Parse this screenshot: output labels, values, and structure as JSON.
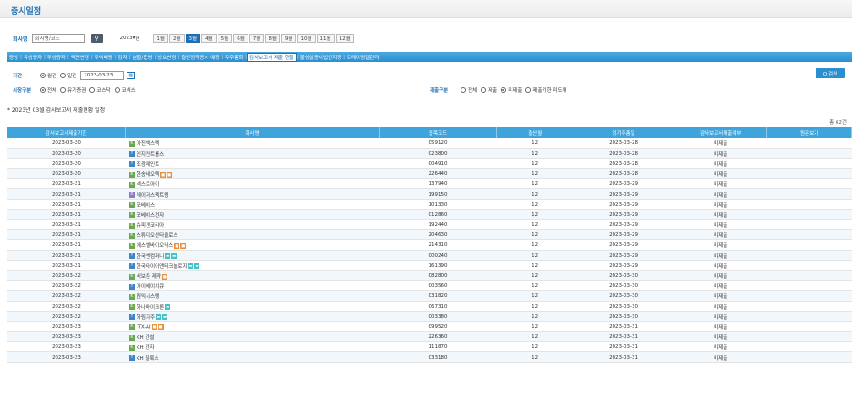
{
  "header": {
    "title": "증시일정"
  },
  "search": {
    "company_label": "회사명",
    "company_placeholder": "회사명/코드",
    "year": "2023",
    "year_suffix": "년",
    "months": [
      "1월",
      "2월",
      "3월",
      "4월",
      "5월",
      "6월",
      "7월",
      "8월",
      "9월",
      "10월",
      "11월",
      "12월"
    ],
    "active_month_index": 2
  },
  "menu": {
    "items": [
      "증암",
      "유상증자",
      "무상증자",
      "액면변경",
      "주식배당",
      "감자",
      "분할/합병",
      "상호변경",
      "결산정적공시 예정",
      "주주총회",
      "감사보고서 제출 현황",
      "불성실공시법인지정",
      "트레이딩캘린더"
    ],
    "active_index": 10
  },
  "filters": {
    "period_label": "기간",
    "period_opt1": "월간",
    "period_opt2": "일간",
    "date_value": "2023-03-23",
    "market_label": "시장구분",
    "market_opts": [
      "전체",
      "유가증권",
      "코스닥",
      "코넥스"
    ],
    "submit_label": "제출구분",
    "submit_opts": [
      "전체",
      "제출",
      "미제출",
      "제출기한 미도래"
    ],
    "search_btn": "Q 검색"
  },
  "caption": "* 2023년 03월 감사보고서 제출현황 일정",
  "total": "총 62건",
  "table": {
    "headers": [
      "감사보고서제출기한",
      "회사명",
      "종목코드",
      "결산월",
      "정기주총일",
      "감사보고서제출여부",
      "원문보기"
    ],
    "rows": [
      {
        "deadline": "2023-03-20",
        "mkt": "k",
        "name": "아진엑스텍",
        "tags": [],
        "code": "059120",
        "month": "12",
        "agm": "2023-03-28",
        "status": "미제출"
      },
      {
        "deadline": "2023-03-20",
        "mkt": "y",
        "name": "인지컨트롤스",
        "tags": [],
        "code": "023800",
        "month": "12",
        "agm": "2023-03-28",
        "status": "미제출"
      },
      {
        "deadline": "2023-03-20",
        "mkt": "y",
        "name": "조광페인트",
        "tags": [],
        "code": "004910",
        "month": "12",
        "agm": "2023-03-28",
        "status": "미제출"
      },
      {
        "deadline": "2023-03-20",
        "mkt": "k",
        "name": "한송네오텍",
        "tags": [
          "o",
          "o"
        ],
        "code": "226440",
        "month": "12",
        "agm": "2023-03-28",
        "status": "미제출"
      },
      {
        "deadline": "2023-03-21",
        "mkt": "k",
        "name": "넥스트아이",
        "tags": [],
        "code": "137940",
        "month": "12",
        "agm": "2023-03-29",
        "status": "미제출"
      },
      {
        "deadline": "2023-03-21",
        "mkt": "x",
        "name": "레이저스펙트럼",
        "tags": [],
        "code": "199150",
        "month": "12",
        "agm": "2023-03-29",
        "status": "미제출"
      },
      {
        "deadline": "2023-03-21",
        "mkt": "k",
        "name": "모베이스",
        "tags": [],
        "code": "101330",
        "month": "12",
        "agm": "2023-03-29",
        "status": "미제출"
      },
      {
        "deadline": "2023-03-21",
        "mkt": "k",
        "name": "모베이스전자",
        "tags": [],
        "code": "012860",
        "month": "12",
        "agm": "2023-03-29",
        "status": "미제출"
      },
      {
        "deadline": "2023-03-21",
        "mkt": "k",
        "name": "슈피겐코리아",
        "tags": [],
        "code": "192440",
        "month": "12",
        "agm": "2023-03-29",
        "status": "미제출"
      },
      {
        "deadline": "2023-03-21",
        "mkt": "k",
        "name": "스튜디오산타클로스",
        "tags": [],
        "code": "204630",
        "month": "12",
        "agm": "2023-03-29",
        "status": "미제출"
      },
      {
        "deadline": "2023-03-21",
        "mkt": "k",
        "name": "에스엘바이오닉스",
        "tags": [
          "o",
          "o"
        ],
        "code": "214310",
        "month": "12",
        "agm": "2023-03-29",
        "status": "미제출"
      },
      {
        "deadline": "2023-03-21",
        "mkt": "y",
        "name": "한국앤컴퍼니",
        "tags": [
          "t",
          "t"
        ],
        "code": "000240",
        "month": "12",
        "agm": "2023-03-29",
        "status": "미제출"
      },
      {
        "deadline": "2023-03-21",
        "mkt": "y",
        "name": "한국타이어앤테크놀로지",
        "tags": [
          "t",
          "t"
        ],
        "code": "161390",
        "month": "12",
        "agm": "2023-03-29",
        "status": "미제출"
      },
      {
        "deadline": "2023-03-22",
        "mkt": "k",
        "name": "비보존 제약",
        "tags": [
          "o"
        ],
        "code": "082800",
        "month": "12",
        "agm": "2023-03-30",
        "status": "미제출"
      },
      {
        "deadline": "2023-03-22",
        "mkt": "y",
        "name": "아이에이치큐",
        "tags": [],
        "code": "003560",
        "month": "12",
        "agm": "2023-03-30",
        "status": "미제출"
      },
      {
        "deadline": "2023-03-22",
        "mkt": "k",
        "name": "원익시스템",
        "tags": [],
        "code": "031820",
        "month": "12",
        "agm": "2023-03-30",
        "status": "미제출"
      },
      {
        "deadline": "2023-03-22",
        "mkt": "k",
        "name": "하나마이크론",
        "tags": [
          "t"
        ],
        "code": "067310",
        "month": "12",
        "agm": "2023-03-30",
        "status": "미제출"
      },
      {
        "deadline": "2023-03-22",
        "mkt": "y",
        "name": "하림지주",
        "tags": [
          "t",
          "t"
        ],
        "code": "003380",
        "month": "12",
        "agm": "2023-03-30",
        "status": "미제출"
      },
      {
        "deadline": "2023-03-23",
        "mkt": "k",
        "name": "ITX-AI",
        "tags": [
          "o",
          "o"
        ],
        "code": "099520",
        "month": "12",
        "agm": "2023-03-31",
        "status": "미제출"
      },
      {
        "deadline": "2023-03-23",
        "mkt": "k",
        "name": "KH 건설",
        "tags": [],
        "code": "226360",
        "month": "12",
        "agm": "2023-03-31",
        "status": "미제출"
      },
      {
        "deadline": "2023-03-23",
        "mkt": "k",
        "name": "KH 전자",
        "tags": [],
        "code": "111870",
        "month": "12",
        "agm": "2023-03-31",
        "status": "미제출"
      },
      {
        "deadline": "2023-03-23",
        "mkt": "y",
        "name": "KH 필룩스",
        "tags": [],
        "code": "033180",
        "month": "12",
        "agm": "2023-03-31",
        "status": "미제출"
      }
    ]
  }
}
